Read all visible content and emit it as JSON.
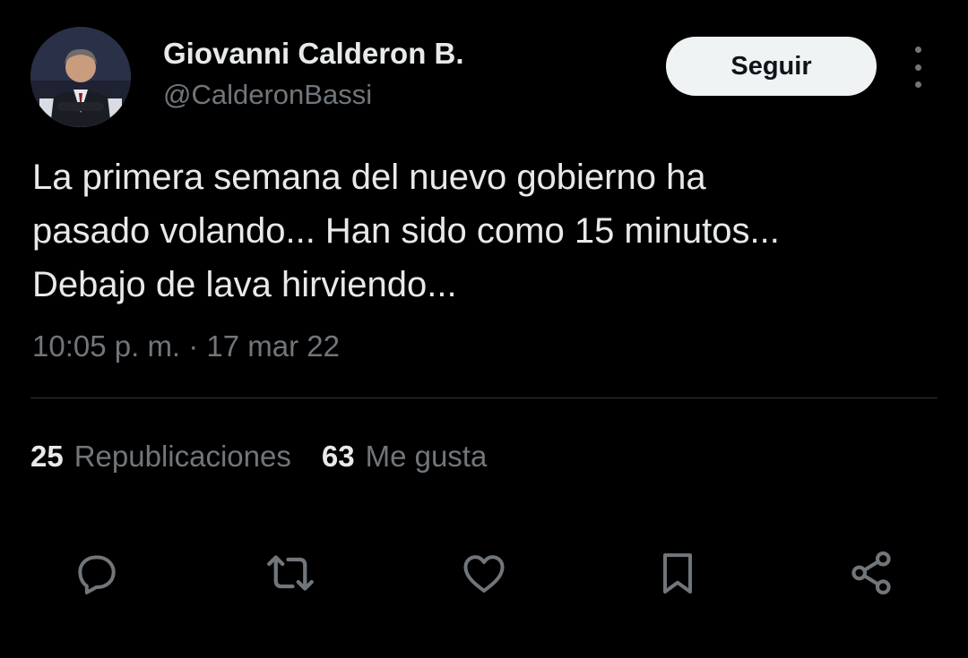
{
  "author": {
    "display_name": "Giovanni Calderon B.",
    "handle": "@CalderonBassi",
    "avatar": "profile-photo"
  },
  "follow_button": {
    "label": "Seguir"
  },
  "more_button": {
    "icon": "more-vertical-icon"
  },
  "tweet": {
    "lines": [
      "La primera semana del nuevo gobierno ha",
      "pasado volando... Han sido como 15 minutos...",
      "Debajo de lava hirviendo..."
    ],
    "timestamp": "10:05 p. m. · 17 mar 22"
  },
  "stats": {
    "reposts": {
      "count": "25",
      "label": "Republicaciones"
    },
    "likes": {
      "count": "63",
      "label": "Me gusta"
    }
  },
  "actions": [
    {
      "name": "reply",
      "icon": "reply-icon"
    },
    {
      "name": "repost",
      "icon": "repost-icon"
    },
    {
      "name": "like",
      "icon": "heart-icon"
    },
    {
      "name": "bookmark",
      "icon": "bookmark-icon"
    },
    {
      "name": "share",
      "icon": "share-icon"
    }
  ],
  "colors": {
    "background": "#000000",
    "primary_text": "#e7e9ea",
    "secondary_text": "#71767b",
    "divider": "#2f3336",
    "button_bg": "#eff3f4",
    "button_text": "#0f1419"
  }
}
